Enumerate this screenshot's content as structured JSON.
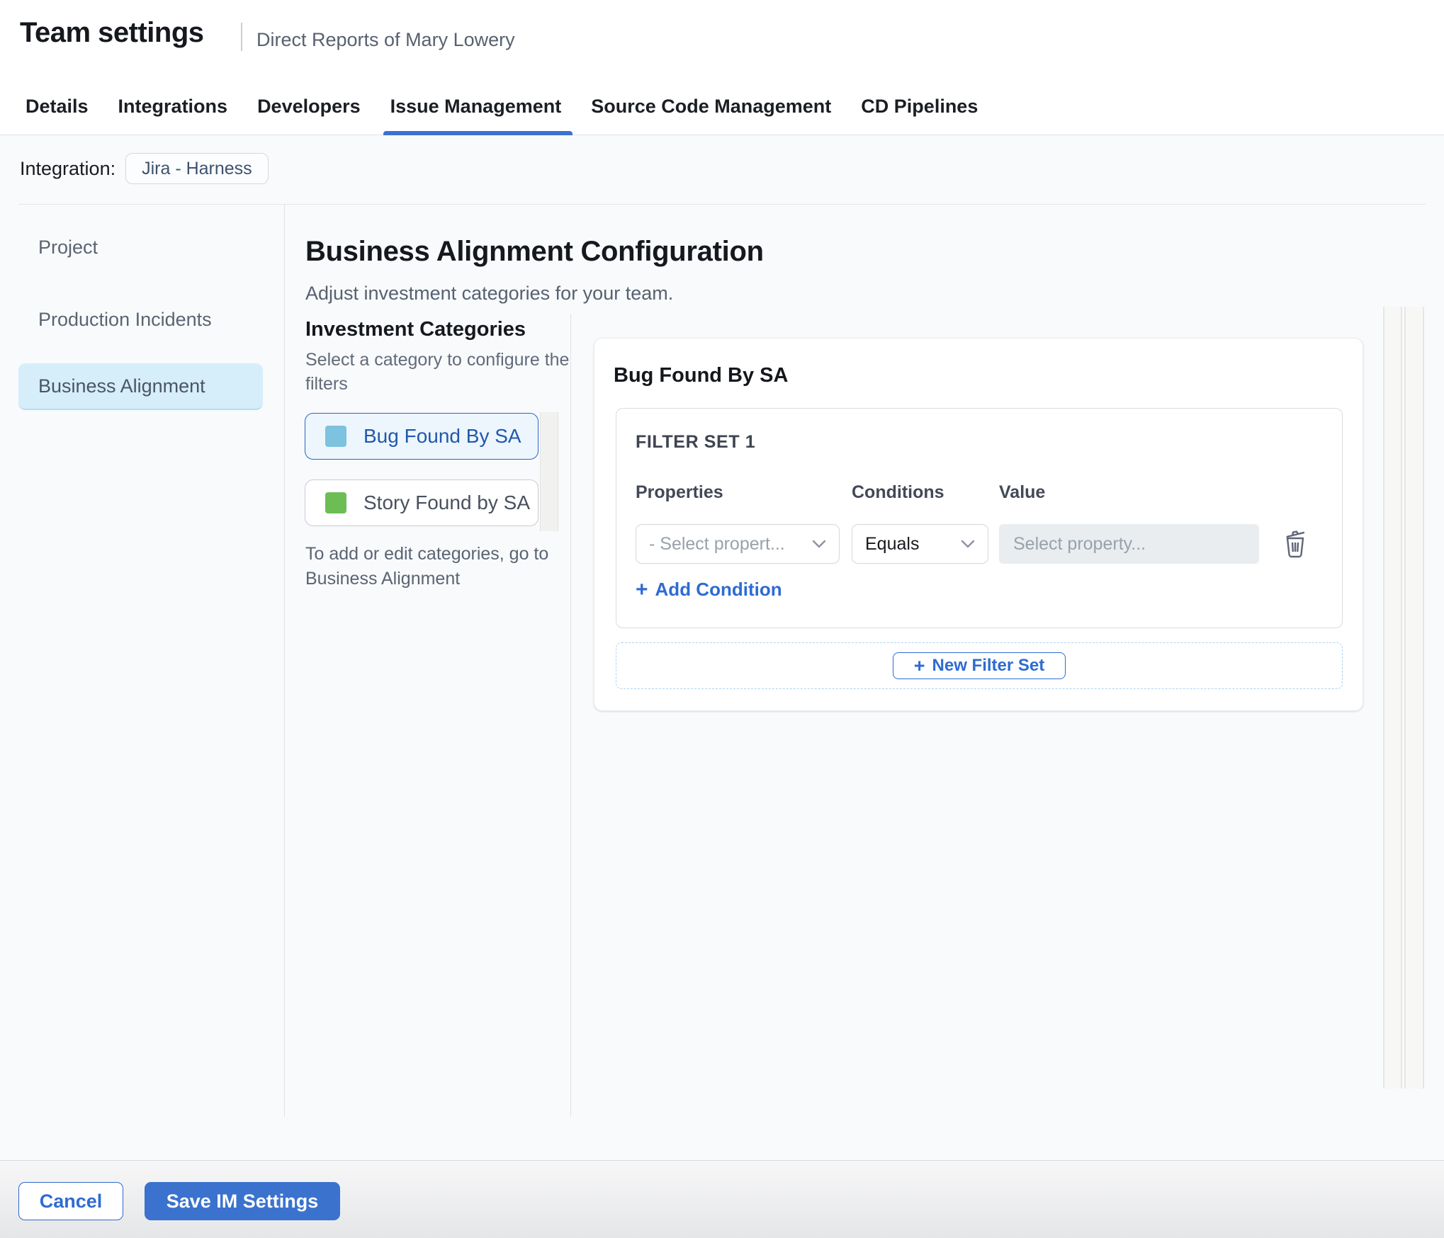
{
  "header": {
    "title": "Team settings",
    "subtitle": "Direct Reports of Mary Lowery",
    "tabs": [
      {
        "label": "Details",
        "active": false
      },
      {
        "label": "Integrations",
        "active": false
      },
      {
        "label": "Developers",
        "active": false
      },
      {
        "label": "Issue Management",
        "active": true
      },
      {
        "label": "Source Code Management",
        "active": false
      },
      {
        "label": "CD Pipelines",
        "active": false
      }
    ]
  },
  "integration_bar": {
    "label": "Integration:",
    "chip": "Jira - Harness"
  },
  "sidebar": {
    "items": [
      {
        "label": "Project",
        "selected": false
      },
      {
        "label": "Production Incidents",
        "selected": false
      },
      {
        "label": "Business Alignment",
        "selected": true
      }
    ]
  },
  "main": {
    "title": "Business Alignment Configuration",
    "subtitle": "Adjust investment categories for your team.",
    "categories": {
      "heading": "Investment Categories",
      "helper_lines": [
        "Select a category to configure the",
        "filters"
      ],
      "items": [
        {
          "label": "Bug Found By SA",
          "swatch_color": "#7dc2de",
          "selected": true
        },
        {
          "label": "Story Found by SA",
          "swatch_color": "#6cbe54",
          "selected": false
        }
      ],
      "note_lines": [
        "To add or edit categories, go to",
        "Business Alignment"
      ]
    },
    "panel": {
      "heading": "Bug Found By SA",
      "filter_set_title": "FILTER SET 1",
      "columns": {
        "properties": "Properties",
        "conditions": "Conditions",
        "value": "Value"
      },
      "row": {
        "property_placeholder": "- Select propert...",
        "condition": "Equals",
        "value_placeholder": "Select property..."
      },
      "add_condition": "Add Condition",
      "new_filter_set": "New Filter Set"
    }
  },
  "footer": {
    "cancel": "Cancel",
    "save": "Save IM Settings"
  },
  "icons": {
    "plus": "+"
  },
  "colors": {
    "accent": "#2e6bd3",
    "save_button_bg": "#3a72ce",
    "tab_underline": "#3b72d0",
    "selected_category_bg": "#edf6fc",
    "sidebar_selected_bg": "#d5eefa",
    "swatch_blue": "#7dc2de",
    "swatch_green": "#6cbe54",
    "value_input_bg": "#e9edf0",
    "dashed_border": "#aed3ee"
  }
}
